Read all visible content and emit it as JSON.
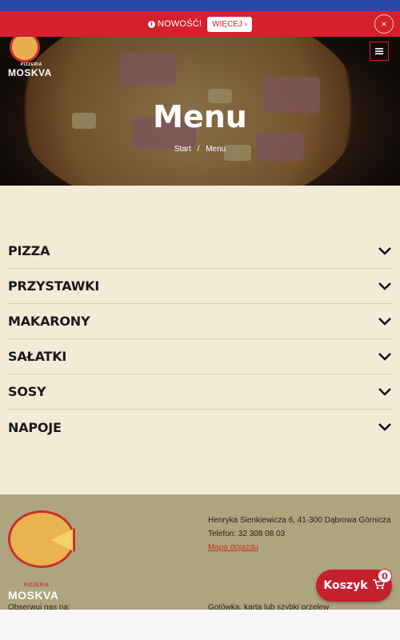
{
  "notice": {
    "label": "NOWOŚĆ!",
    "more_button": "WIĘCEJ ›",
    "close_label": "×"
  },
  "hero": {
    "brand_prefix": "PIZZERIA",
    "brand_name": "MOSKVA",
    "title": "Menu",
    "breadcrumb": [
      "Start",
      "Menu"
    ]
  },
  "menu": {
    "items": [
      {
        "label": "PIZZA"
      },
      {
        "label": "PRZYSTAWKI"
      },
      {
        "label": "MAKARONY"
      },
      {
        "label": "SAŁATKI"
      },
      {
        "label": "SOSY"
      },
      {
        "label": "NAPOJE"
      }
    ]
  },
  "footer": {
    "brand_prefix": "PIZZERIA",
    "brand_name": "MOSKVA",
    "address": "Henryka Sienkiewicza 6, 41-300 Dąbrowa Górnicza",
    "phone": "Telefon: 32 308 08 03",
    "map_link": "Mapa dojazdu",
    "follow": "Obserwuj nas na:",
    "payment": "Gotówka, karta lub szybki przelew"
  },
  "cart": {
    "label": "Koszyk",
    "count": "0"
  },
  "colors": {
    "accent_red": "#d6202d",
    "top_blue": "#2a48a8",
    "page_bg": "#f4ebd6",
    "footer_bg": "#aea57f"
  }
}
